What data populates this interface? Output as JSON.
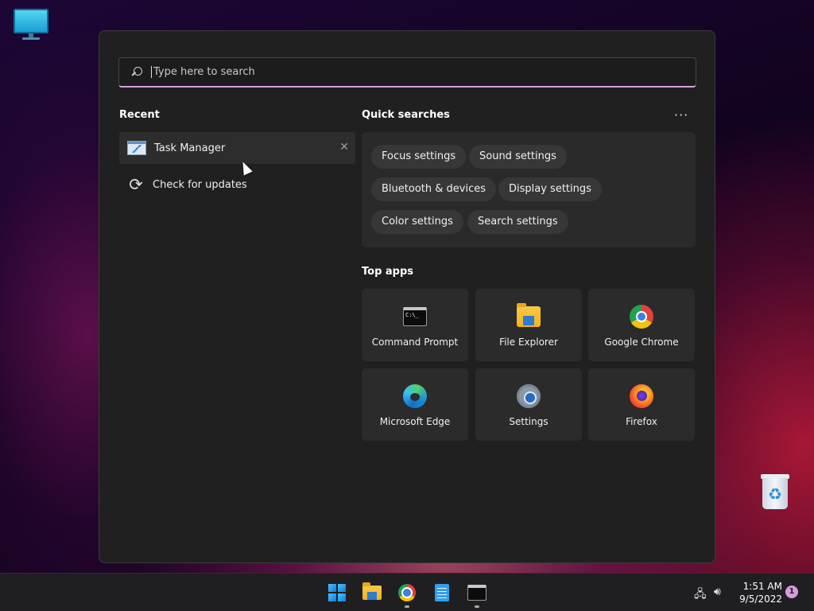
{
  "search": {
    "placeholder": "Type here to search"
  },
  "recent": {
    "title": "Recent",
    "items": [
      {
        "label": "Task Manager",
        "icon": "task-manager-icon"
      },
      {
        "label": "Check for updates",
        "icon": "refresh-icon"
      }
    ]
  },
  "quick_searches": {
    "title": "Quick searches",
    "more": "···",
    "chips": [
      "Focus settings",
      "Sound settings",
      "Bluetooth & devices",
      "Display settings",
      "Color settings",
      "Search settings"
    ]
  },
  "top_apps": {
    "title": "Top apps",
    "apps": [
      {
        "label": "Command Prompt",
        "icon": "command-prompt-icon"
      },
      {
        "label": "File Explorer",
        "icon": "file-explorer-icon"
      },
      {
        "label": "Google Chrome",
        "icon": "chrome-icon"
      },
      {
        "label": "Microsoft Edge",
        "icon": "edge-icon"
      },
      {
        "label": "Settings",
        "icon": "settings-icon"
      },
      {
        "label": "Firefox",
        "icon": "firefox-icon"
      }
    ]
  },
  "taskbar": {
    "apps": [
      "start-icon",
      "file-explorer-icon",
      "chrome-icon",
      "notepad-icon",
      "command-prompt-icon"
    ],
    "time": "1:51 AM",
    "date": "9/5/2022",
    "notification_count": "1"
  }
}
